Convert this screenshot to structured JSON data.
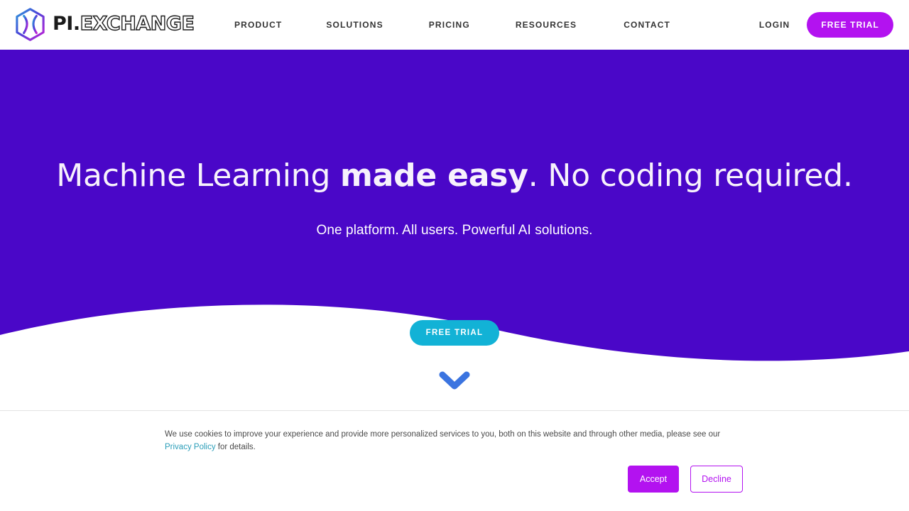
{
  "brand": {
    "logo_icon": "hexagon-x-logo-icon",
    "name_bold": "PI.",
    "name_outline": "EXCHANGE",
    "colors": {
      "hero_purple": "#4a07c8",
      "accent_magenta": "#b312f0",
      "accent_cyan": "#12b2d6",
      "chevron_blue": "#3b74e0",
      "link_teal": "#2a9db8"
    }
  },
  "header": {
    "nav": [
      {
        "label": "PRODUCT"
      },
      {
        "label": "SOLUTIONS"
      },
      {
        "label": "PRICING"
      },
      {
        "label": "RESOURCES"
      },
      {
        "label": "CONTACT"
      }
    ],
    "login_label": "LOGIN",
    "trial_label": "FREE TRIAL"
  },
  "hero": {
    "title_part1": "Machine Learning ",
    "title_bold": "made easy",
    "title_part2": ". No coding required.",
    "subtitle": "One platform. All users. Powerful AI solutions.",
    "cta_label": "FREE TRIAL",
    "scroll_icon": "chevron-down-icon"
  },
  "cookie": {
    "text_before_link": "We use cookies to improve your experience and provide more personalized services to you, both on this website and through other media, please see our ",
    "link_label": "Privacy Policy",
    "text_after_link": " for details.",
    "accept_label": "Accept",
    "decline_label": "Decline"
  }
}
